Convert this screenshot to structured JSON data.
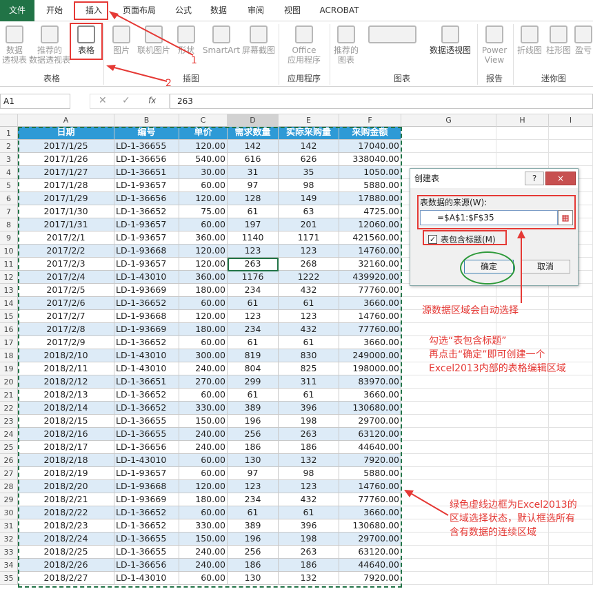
{
  "tabs": [
    "文件",
    "开始",
    "插入",
    "页面布局",
    "公式",
    "数据",
    "审阅",
    "视图",
    "ACROBAT"
  ],
  "ribbon": {
    "pivot": "数据\n透视表",
    "rec_pivot": "推荐的\n数据透视表",
    "table": "表格",
    "picture": "图片",
    "online_picture": "联机图片",
    "shapes": "形状",
    "smartart": "SmartArt",
    "screenshot": "屏幕截图",
    "office": "Office\n应用程序",
    "rec_charts": "推荐的\n图表",
    "pivot_chart": "数据透视图",
    "power_view": "Power\nView",
    "line": "折线图",
    "column": "柱形图",
    "winloss": "盈亏",
    "groups": {
      "table": "表格",
      "illus": "插图",
      "apps": "应用程序",
      "charts": "图表",
      "reports": "报告",
      "spark": "迷你图"
    }
  },
  "namebox": "A1",
  "formula": "263",
  "columns": [
    "A",
    "B",
    "C",
    "D",
    "E",
    "F",
    "G",
    "H",
    "I"
  ],
  "headers": [
    "日期",
    "编号",
    "单价",
    "需求数量",
    "实际采购量",
    "采购金额"
  ],
  "rows": [
    [
      "2017/1/25",
      "LD-1-36655",
      "120.00",
      "142",
      "142",
      "17040.00"
    ],
    [
      "2017/1/26",
      "LD-1-36656",
      "540.00",
      "616",
      "626",
      "338040.00"
    ],
    [
      "2017/1/27",
      "LD-1-36651",
      "30.00",
      "31",
      "35",
      "1050.00"
    ],
    [
      "2017/1/28",
      "LD-1-93657",
      "60.00",
      "97",
      "98",
      "5880.00"
    ],
    [
      "2017/1/29",
      "LD-1-36656",
      "120.00",
      "128",
      "149",
      "17880.00"
    ],
    [
      "2017/1/30",
      "LD-1-36652",
      "75.00",
      "61",
      "63",
      "4725.00"
    ],
    [
      "2017/1/31",
      "LD-1-93657",
      "60.00",
      "197",
      "201",
      "12060.00"
    ],
    [
      "2017/2/1",
      "LD-1-93657",
      "360.00",
      "1140",
      "1171",
      "421560.00"
    ],
    [
      "2017/2/2",
      "LD-1-93668",
      "120.00",
      "123",
      "123",
      "14760.00"
    ],
    [
      "2017/2/3",
      "LD-1-93657",
      "120.00",
      "263",
      "268",
      "32160.00"
    ],
    [
      "2017/2/4",
      "LD-1-43010",
      "360.00",
      "1176",
      "1222",
      "439920.00"
    ],
    [
      "2017/2/5",
      "LD-1-93669",
      "180.00",
      "234",
      "432",
      "77760.00"
    ],
    [
      "2017/2/6",
      "LD-1-36652",
      "60.00",
      "61",
      "61",
      "3660.00"
    ],
    [
      "2017/2/7",
      "LD-1-93668",
      "120.00",
      "123",
      "123",
      "14760.00"
    ],
    [
      "2017/2/8",
      "LD-1-93669",
      "180.00",
      "234",
      "432",
      "77760.00"
    ],
    [
      "2017/2/9",
      "LD-1-36652",
      "60.00",
      "61",
      "61",
      "3660.00"
    ],
    [
      "2018/2/10",
      "LD-1-43010",
      "300.00",
      "819",
      "830",
      "249000.00"
    ],
    [
      "2018/2/11",
      "LD-1-43010",
      "240.00",
      "804",
      "825",
      "198000.00"
    ],
    [
      "2018/2/12",
      "LD-1-36651",
      "270.00",
      "299",
      "311",
      "83970.00"
    ],
    [
      "2018/2/13",
      "LD-1-36652",
      "60.00",
      "61",
      "61",
      "3660.00"
    ],
    [
      "2018/2/14",
      "LD-1-36652",
      "330.00",
      "389",
      "396",
      "130680.00"
    ],
    [
      "2018/2/15",
      "LD-1-36655",
      "150.00",
      "196",
      "198",
      "29700.00"
    ],
    [
      "2018/2/16",
      "LD-1-36655",
      "240.00",
      "256",
      "263",
      "63120.00"
    ],
    [
      "2018/2/17",
      "LD-1-36656",
      "240.00",
      "186",
      "186",
      "44640.00"
    ],
    [
      "2018/2/18",
      "LD-1-43010",
      "60.00",
      "130",
      "132",
      "7920.00"
    ],
    [
      "2018/2/19",
      "LD-1-93657",
      "60.00",
      "97",
      "98",
      "5880.00"
    ],
    [
      "2018/2/20",
      "LD-1-93668",
      "120.00",
      "123",
      "123",
      "14760.00"
    ],
    [
      "2018/2/21",
      "LD-1-93669",
      "180.00",
      "234",
      "432",
      "77760.00"
    ],
    [
      "2018/2/22",
      "LD-1-36652",
      "60.00",
      "61",
      "61",
      "3660.00"
    ],
    [
      "2018/2/23",
      "LD-1-36652",
      "330.00",
      "389",
      "396",
      "130680.00"
    ],
    [
      "2018/2/24",
      "LD-1-36655",
      "150.00",
      "196",
      "198",
      "29700.00"
    ],
    [
      "2018/2/25",
      "LD-1-36655",
      "240.00",
      "256",
      "263",
      "63120.00"
    ],
    [
      "2018/2/26",
      "LD-1-36656",
      "240.00",
      "186",
      "186",
      "44640.00"
    ],
    [
      "2018/2/27",
      "LD-1-43010",
      "60.00",
      "130",
      "132",
      "7920.00"
    ]
  ],
  "dialog": {
    "title": "创建表",
    "help": "?",
    "close": "×",
    "label": "表数据的来源(W):",
    "range": "=$A$1:$F$35",
    "checkbox": "表包含标题(M)",
    "ok": "确定",
    "cancel": "取消"
  },
  "annotations": {
    "num1": "1",
    "num2": "2",
    "auto": "源数据区域会自动选择",
    "tip1": "勾选“表包含标题”",
    "tip2": "再点击“确定”即可创建一个",
    "tip3": "Excel2013内部的表格编辑区域",
    "green1": "绿色虚线边框为Excel2013的",
    "green2": "区域选择状态，默认框选所有",
    "green3": "含有数据的连续区域"
  },
  "colors": {
    "excel_green": "#217346",
    "header_blue": "#2e9ad6",
    "band_blue": "#ddebf7",
    "annotation_red": "#e53935"
  }
}
